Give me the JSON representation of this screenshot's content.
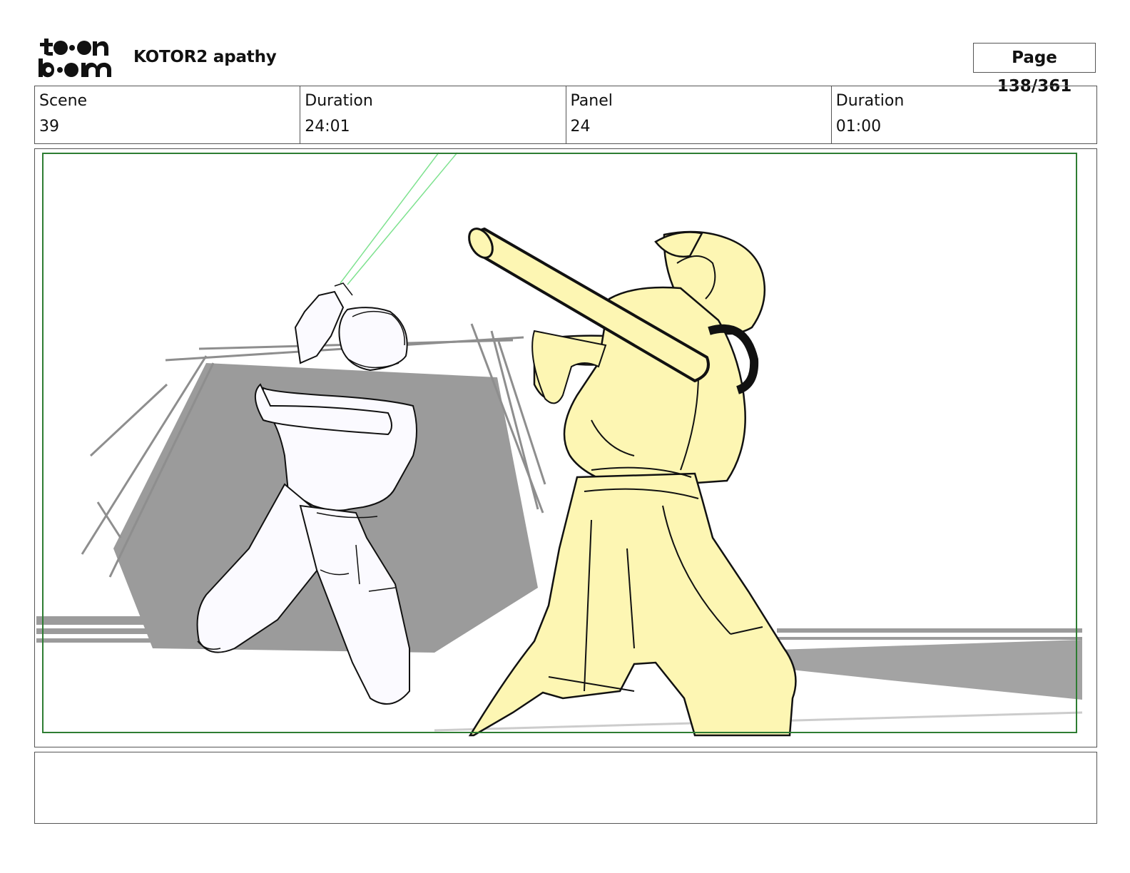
{
  "header": {
    "logo_text": "toon boom",
    "project_title": "KOTOR2 apathy",
    "page_indicator": "Page 138/361"
  },
  "info": {
    "scene_label": "Scene",
    "scene_value": "39",
    "scene_duration_label": "Duration",
    "scene_duration_value": "24:01",
    "panel_label": "Panel",
    "panel_value": "24",
    "panel_duration_label": "Duration",
    "panel_duration_value": "01:00"
  },
  "panel": {
    "safe_frame_color": "#2e7d32",
    "shadow_color": "#9b9b9b",
    "saber_color": "#7ee28f",
    "character_fill_color": "#fdf6b3"
  },
  "notes": {
    "text": ""
  }
}
